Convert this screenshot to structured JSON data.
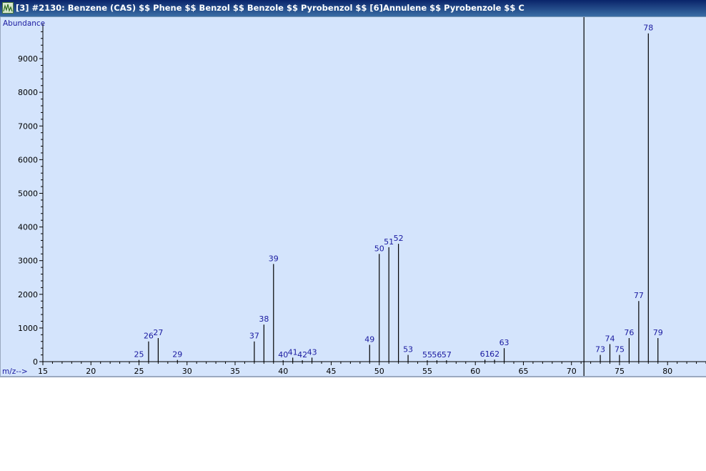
{
  "window": {
    "title": "[3] #2130: Benzene (CAS) $$ Phene $$ Benzol $$ Benzole $$ Pyrobenzol $$ [6]Annulene $$ Pyrobenzole $$ C",
    "icon": "spectrum-app-icon"
  },
  "colors": {
    "plot_background": "#d4e4fc",
    "peak_line": "#000000",
    "peak_label": "#1a1aa0",
    "title_bar": "#0a246a"
  },
  "chart_data": {
    "type": "bar",
    "ylabel": "Abundance",
    "xlabel": "m/z-->",
    "xlim": [
      15,
      84
    ],
    "ylim": [
      0,
      9999
    ],
    "x_ticks": [
      15,
      20,
      25,
      30,
      35,
      40,
      45,
      50,
      55,
      60,
      65,
      70,
      75,
      80
    ],
    "y_ticks": [
      0,
      1000,
      2000,
      3000,
      4000,
      5000,
      6000,
      7000,
      8000,
      9000
    ],
    "grid": false,
    "cursor_line_x": 71.3,
    "peaks": [
      {
        "mz": 25,
        "label": "25",
        "abundance": 50
      },
      {
        "mz": 26,
        "label": "26",
        "abundance": 600
      },
      {
        "mz": 27,
        "label": "27",
        "abundance": 700
      },
      {
        "mz": 29,
        "label": "29",
        "abundance": 50
      },
      {
        "mz": 37,
        "label": "37",
        "abundance": 600
      },
      {
        "mz": 38,
        "label": "38",
        "abundance": 1100
      },
      {
        "mz": 39,
        "label": "39",
        "abundance": 2900
      },
      {
        "mz": 40,
        "label": "40",
        "abundance": 40
      },
      {
        "mz": 41,
        "label": "41",
        "abundance": 120
      },
      {
        "mz": 42,
        "label": "42",
        "abundance": 40
      },
      {
        "mz": 43,
        "label": "43",
        "abundance": 120
      },
      {
        "mz": 49,
        "label": "49",
        "abundance": 500
      },
      {
        "mz": 50,
        "label": "50",
        "abundance": 3200
      },
      {
        "mz": 51,
        "label": "51",
        "abundance": 3400
      },
      {
        "mz": 52,
        "label": "52",
        "abundance": 3500
      },
      {
        "mz": 53,
        "label": "53",
        "abundance": 200
      },
      {
        "mz": 55,
        "label": "55",
        "abundance": 40
      },
      {
        "mz": 56,
        "label": "56",
        "abundance": 40
      },
      {
        "mz": 57,
        "label": "57",
        "abundance": 40
      },
      {
        "mz": 61,
        "label": "61",
        "abundance": 60
      },
      {
        "mz": 62,
        "label": "62",
        "abundance": 60
      },
      {
        "mz": 63,
        "label": "63",
        "abundance": 400
      },
      {
        "mz": 73,
        "label": "73",
        "abundance": 200
      },
      {
        "mz": 74,
        "label": "74",
        "abundance": 520
      },
      {
        "mz": 75,
        "label": "75",
        "abundance": 200
      },
      {
        "mz": 76,
        "label": "76",
        "abundance": 700
      },
      {
        "mz": 77,
        "label": "77",
        "abundance": 1800
      },
      {
        "mz": 78,
        "label": "78",
        "abundance": 9750
      },
      {
        "mz": 79,
        "label": "79",
        "abundance": 700
      }
    ]
  }
}
